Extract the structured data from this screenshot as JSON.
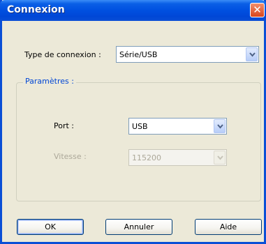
{
  "window": {
    "title": "Connexion",
    "close_glyph": "✕"
  },
  "connection_type": {
    "label": "Type de connexion :",
    "value": "Série/USB"
  },
  "parameters": {
    "legend": "Paramètres :",
    "port": {
      "label": "Port :",
      "value": "USB"
    },
    "speed": {
      "label": "Vitesse :",
      "value": "115200",
      "disabled": true
    }
  },
  "buttons": {
    "ok": "OK",
    "cancel": "Annuler",
    "help": "Aide"
  },
  "colors": {
    "titlebar": "#0a4fd6",
    "window_bg": "#ece9d8",
    "group_legend": "#0046d5",
    "disabled_text": "#aca899"
  },
  "icons": {
    "close": "close-icon",
    "dropdown": "chevron-down-icon"
  }
}
